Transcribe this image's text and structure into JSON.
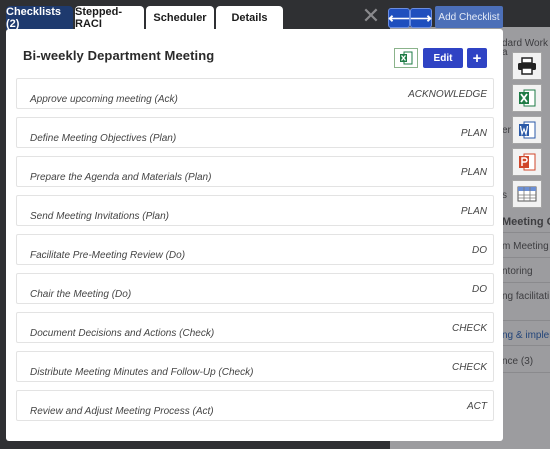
{
  "tabs": [
    {
      "label": "Checklists (2)",
      "active": true
    },
    {
      "label": "Stepped-RACI",
      "active": false
    },
    {
      "label": "Scheduler",
      "active": false
    },
    {
      "label": "Details",
      "active": false
    }
  ],
  "toolbar": {
    "close_glyph": "✕",
    "prev_glyph": "⟵",
    "next_glyph": "⟶",
    "add_checklist_label": "Add Checklist"
  },
  "background": {
    "lines": [
      {
        "text": "dard Work",
        "style": "plain"
      },
      {
        "text": "a",
        "style": "plain"
      },
      {
        "text": "er",
        "style": "plain"
      },
      {
        "text": "s",
        "style": "plain"
      },
      {
        "text": "Meeting G",
        "style": "bold"
      },
      {
        "text": "m Meeting",
        "style": "plain"
      },
      {
        "text": "ntoring",
        "style": "plain"
      },
      {
        "text": "ng facilitati",
        "style": "plain"
      },
      {
        "text": "ng & impler",
        "style": "link"
      },
      {
        "text": "nce (3)",
        "style": "plain"
      }
    ]
  },
  "side_tools": [
    {
      "name": "printer-icon"
    },
    {
      "name": "excel-icon"
    },
    {
      "name": "word-icon"
    },
    {
      "name": "powerpoint-icon"
    },
    {
      "name": "table-icon"
    }
  ],
  "modal": {
    "title": "Bi-weekly Department Meeting",
    "edit_label": "Edit",
    "plus_label": "+",
    "excel_label": "X",
    "items": [
      {
        "text": "Approve upcoming meeting (Ack)",
        "tag": "ACKNOWLEDGE"
      },
      {
        "text": "Define Meeting Objectives (Plan)",
        "tag": "PLAN"
      },
      {
        "text": "Prepare the Agenda and Materials (Plan)",
        "tag": "PLAN"
      },
      {
        "text": "Send Meeting Invitations (Plan)",
        "tag": "PLAN"
      },
      {
        "text": "Facilitate Pre-Meeting Review (Do)",
        "tag": "DO"
      },
      {
        "text": "Chair the Meeting (Do)",
        "tag": "DO"
      },
      {
        "text": "Document Decisions and Actions (Check)",
        "tag": "CHECK"
      },
      {
        "text": "Distribute Meeting Minutes and Follow-Up (Check)",
        "tag": "CHECK"
      },
      {
        "text": "Review and Adjust Meeting Process (Act)",
        "tag": "ACT"
      }
    ]
  },
  "colors": {
    "active_tab": "#1e3a6e",
    "primary_button": "#2f43c4",
    "backdrop": "#2f3033"
  }
}
